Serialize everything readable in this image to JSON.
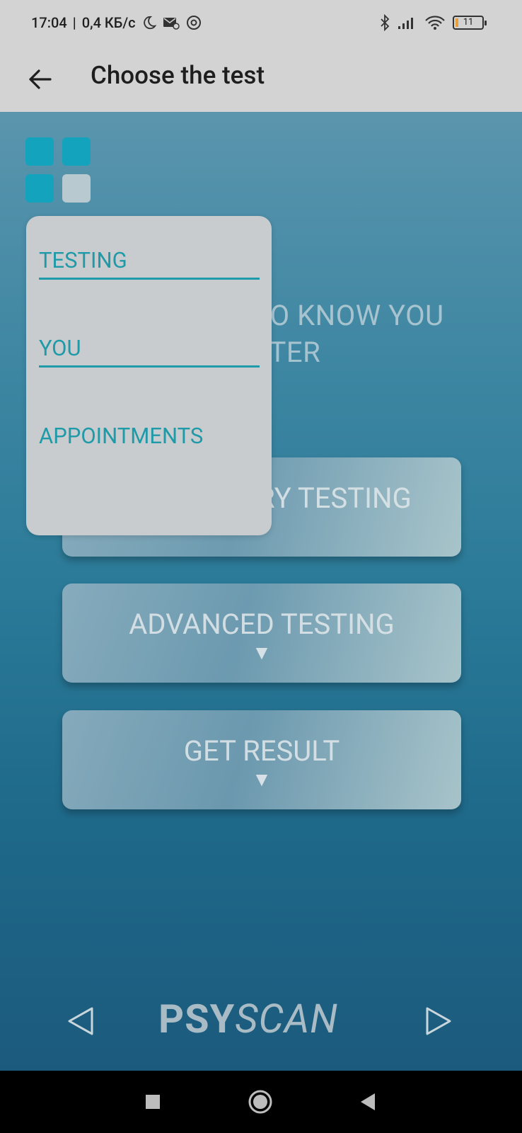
{
  "status": {
    "time": "17:04",
    "separator": "|",
    "speed": "0,4 КБ/с",
    "battery": "11"
  },
  "app_bar": {
    "title": "Choose the test"
  },
  "main": {
    "headline": "LET US GET TO KNOW YOU BETTER",
    "buttons": [
      {
        "label": "PRELIMINARY TESTING",
        "arrow": "▼"
      },
      {
        "label": "ADVANCED TESTING",
        "arrow": "▼"
      },
      {
        "label": "GET RESULT",
        "arrow": "▼"
      }
    ],
    "brand_bold": "PSY",
    "brand_italic": "SCAN"
  },
  "menu": {
    "items": [
      {
        "label": "TESTING"
      },
      {
        "label": "YOU"
      },
      {
        "label": "APPOINTMENTS"
      }
    ]
  },
  "colors": {
    "accent": "#1f9aa8",
    "grid_active": "#14a3bd",
    "grid_inactive": "#b8c9d0",
    "bar_bg": "#d3d3d3"
  },
  "icons": {
    "back": "arrow-left-icon",
    "grid": "grid-menu-icon",
    "prev": "triangle-left-icon",
    "next": "triangle-right-icon"
  }
}
